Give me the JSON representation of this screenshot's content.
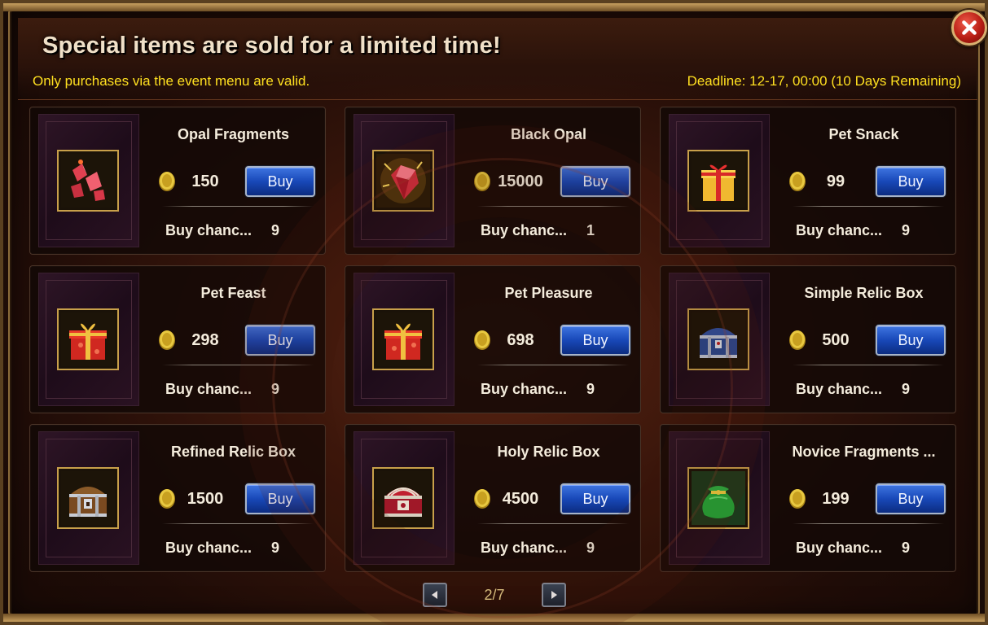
{
  "header": {
    "title": "Special items are sold for a limited time!",
    "subtitle": "Only purchases via the event menu are valid.",
    "deadline": "Deadline: 12-17, 00:00 (10 Days Remaining)"
  },
  "colors": {
    "notice_text": "#ffe020",
    "buy_button": "#1848b8",
    "icon_frame": "#c8a04a"
  },
  "items": [
    {
      "name": "Opal Fragments",
      "icon": "opal-fragments-icon",
      "price": "150",
      "buy_label": "Buy",
      "chance_label": "Buy chanc...",
      "chance_value": "9"
    },
    {
      "name": "Black Opal",
      "icon": "black-opal-icon",
      "price": "15000",
      "buy_label": "Buy",
      "chance_label": "Buy chanc...",
      "chance_value": "1"
    },
    {
      "name": "Pet Snack",
      "icon": "pet-snack-gift-icon",
      "price": "99",
      "buy_label": "Buy",
      "chance_label": "Buy chanc...",
      "chance_value": "9"
    },
    {
      "name": "Pet Feast",
      "icon": "pet-feast-gift-icon",
      "price": "298",
      "buy_label": "Buy",
      "chance_label": "Buy chanc...",
      "chance_value": "9"
    },
    {
      "name": "Pet Pleasure",
      "icon": "pet-pleasure-gift-icon",
      "price": "698",
      "buy_label": "Buy",
      "chance_label": "Buy chanc...",
      "chance_value": "9"
    },
    {
      "name": "Simple Relic Box",
      "icon": "simple-relic-chest-icon",
      "price": "500",
      "buy_label": "Buy",
      "chance_label": "Buy chanc...",
      "chance_value": "9"
    },
    {
      "name": "Refined Relic Box",
      "icon": "refined-relic-chest-icon",
      "price": "1500",
      "buy_label": "Buy",
      "chance_label": "Buy chanc...",
      "chance_value": "9"
    },
    {
      "name": "Holy Relic Box",
      "icon": "holy-relic-chest-icon",
      "price": "4500",
      "buy_label": "Buy",
      "chance_label": "Buy chanc...",
      "chance_value": "9"
    },
    {
      "name": "Novice Fragments ...",
      "icon": "novice-fragments-bag-icon",
      "price": "199",
      "buy_label": "Buy",
      "chance_label": "Buy chanc...",
      "chance_value": "9"
    }
  ],
  "pagination": {
    "page": "2/7"
  }
}
